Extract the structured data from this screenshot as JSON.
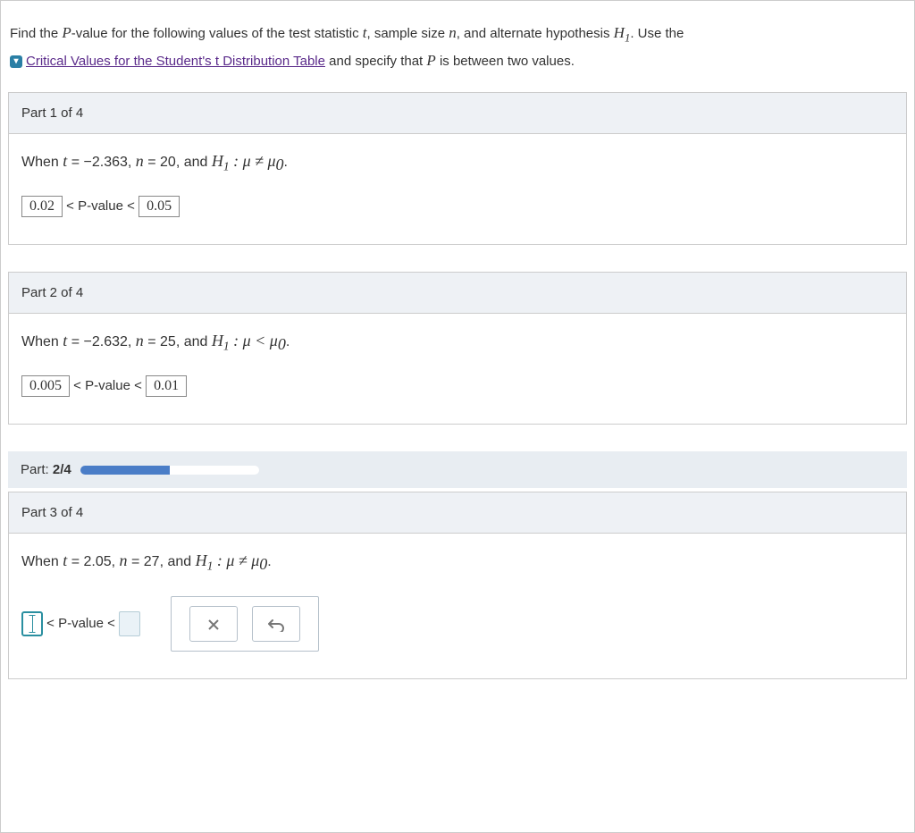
{
  "intro": {
    "prefix": "Find the ",
    "Pvar": "P",
    "mid1": "-value for the following values of the test statistic ",
    "tvar": "t",
    "mid2": ", sample size ",
    "nvar": "n",
    "mid3": ", and alternate hypothesis ",
    "H1var": "H",
    "H1sub": "1",
    "mid4": ". Use the",
    "link_text": "Critical Values for the Student's t Distribution Table",
    "tail": " and specify that ",
    "Pvar2": "P",
    "tail2": " is between two values."
  },
  "parts": {
    "p1": {
      "header": "Part 1 of 4",
      "when_prefix": "When ",
      "t_label": "t",
      "eq1": " = −2.363, ",
      "n_label": "n",
      "eq2": " = 20,  and ",
      "H_label": "H",
      "H_sub": "1",
      "hyp": " : μ ≠ μ",
      "musub": "0",
      "period": ".",
      "lower": "0.02",
      "pv_label": " < P-value < ",
      "upper": "0.05"
    },
    "p2": {
      "header": "Part 2 of 4",
      "when_prefix": "When ",
      "t_label": "t",
      "eq1": " = −2.632, ",
      "n_label": "n",
      "eq2": " = 25,  and ",
      "H_label": "H",
      "H_sub": "1",
      "hyp": " : μ < μ",
      "musub": "0",
      "period": ".",
      "lower": "0.005",
      "pv_label": " < P-value < ",
      "upper": "0.01"
    },
    "progress": {
      "label_prefix": "Part: ",
      "label_value": "2/4",
      "percent": 50
    },
    "p3": {
      "header": "Part 3 of 4",
      "when_prefix": "When ",
      "t_label": "t",
      "eq1": " = 2.05, ",
      "n_label": "n",
      "eq2": " = 27,  and ",
      "H_label": "H",
      "H_sub": "1",
      "hyp": " : μ ≠ μ",
      "musub": "0",
      "period": ".",
      "pv_label": " < P-value < "
    }
  }
}
